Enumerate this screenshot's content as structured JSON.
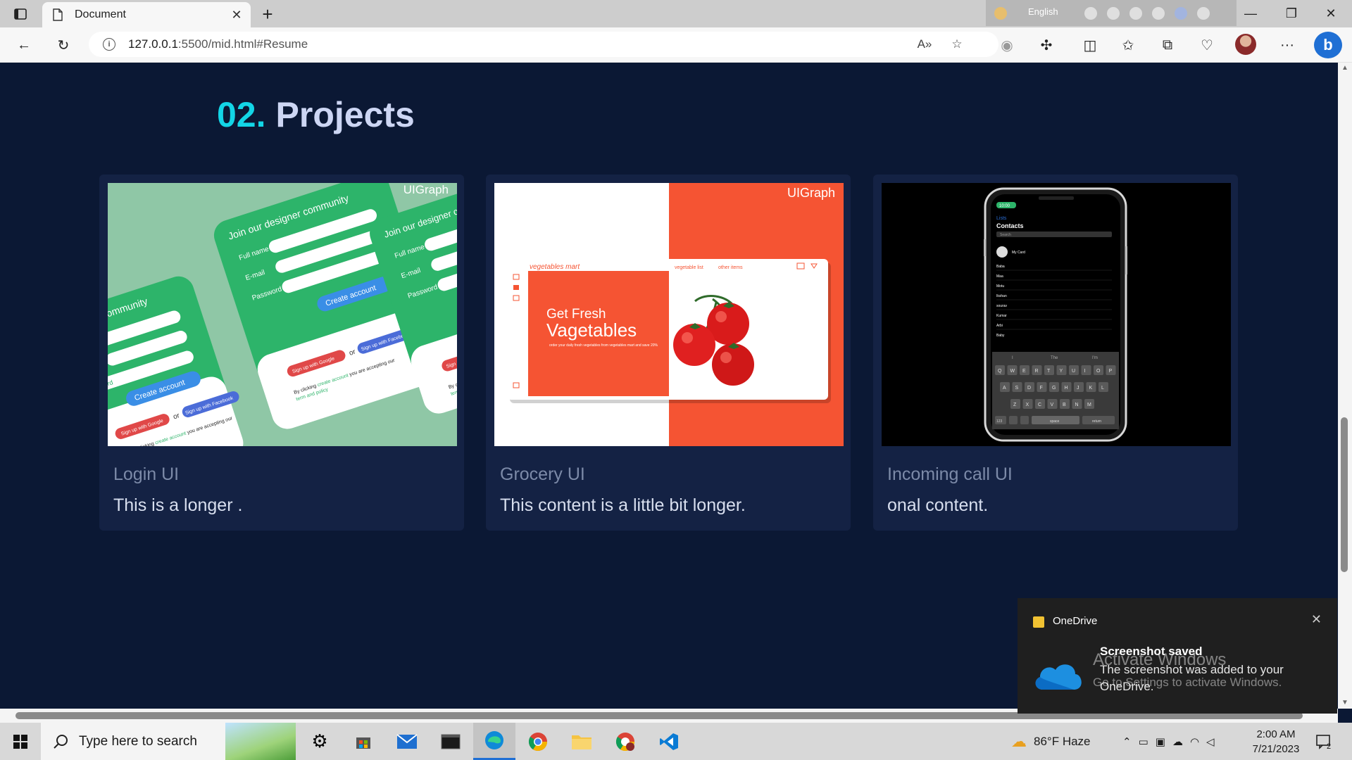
{
  "browser": {
    "tab_title": "Document",
    "url_host": "127.0.0.1",
    "url_rest": ":5500/mid.html#Resume",
    "language": "English"
  },
  "section": {
    "number": "02.",
    "title": "Projects"
  },
  "projects": [
    {
      "title": "Login UI",
      "text": "This is a longer .",
      "watermark": "UIGraph",
      "image": {
        "heading": "Join our designer community",
        "fields": [
          "Full name",
          "E-mail",
          "Password"
        ],
        "cta": "Create account",
        "google": "Sign up with Google",
        "facebook": "Sign up with Facebook",
        "or": "or",
        "terms_prefix": "By clicking",
        "terms_link": "create account",
        "terms_suffix": "you are accepting our",
        "terms_policy": "term and policy",
        "left_heading": "ner community",
        "left_field": "word"
      }
    },
    {
      "title": "Grocery UI",
      "text": "This content is a little bit longer.",
      "watermark": "UIGraph",
      "image": {
        "brand": "vegetables mart",
        "nav1": "vegetable list",
        "nav2": "other items",
        "headline1": "Get Fresh",
        "headline2": "Vagetables",
        "tagline": "order your daily fresh vegetables from vegetables mart and save 20%"
      }
    },
    {
      "title": "Incoming call UI",
      "text": "onal content.",
      "image": {
        "status": "10:00",
        "lists": "Lists",
        "heading": "Contacts",
        "search": "Search",
        "mycard": "My Card",
        "contacts": [
          "Baba",
          "Maa",
          "Motu",
          "Ikshan",
          "sourav",
          "Kumar",
          "Arbi",
          "Baby"
        ],
        "suggestions": [
          "I",
          "The",
          "I'm"
        ],
        "row1": [
          "Q",
          "W",
          "E",
          "R",
          "T",
          "Y",
          "U",
          "I",
          "O",
          "P"
        ],
        "row2": [
          "A",
          "S",
          "D",
          "F",
          "G",
          "H",
          "J",
          "K",
          "L"
        ],
        "row3": [
          "Z",
          "X",
          "C",
          "V",
          "B",
          "N",
          "M"
        ],
        "key123": "123",
        "space": "space",
        "return": "return"
      }
    }
  ],
  "notification": {
    "app": "OneDrive",
    "heading": "Screenshot saved",
    "body": "The screenshot was added to your OneDrive."
  },
  "watermark": {
    "line1": "Activate Windows",
    "line2": "Go to Settings to activate Windows."
  },
  "taskbar": {
    "search_placeholder": "Type here to search",
    "weather": "86°F  Haze",
    "time": "2:00 AM",
    "date": "7/21/2023",
    "notif_count": "2"
  },
  "colors": {
    "page_bg": "#0b1834",
    "card_bg": "#142244",
    "accent": "#13d5e6",
    "login_green": "#2db46a",
    "grocery_red": "#f55433"
  }
}
